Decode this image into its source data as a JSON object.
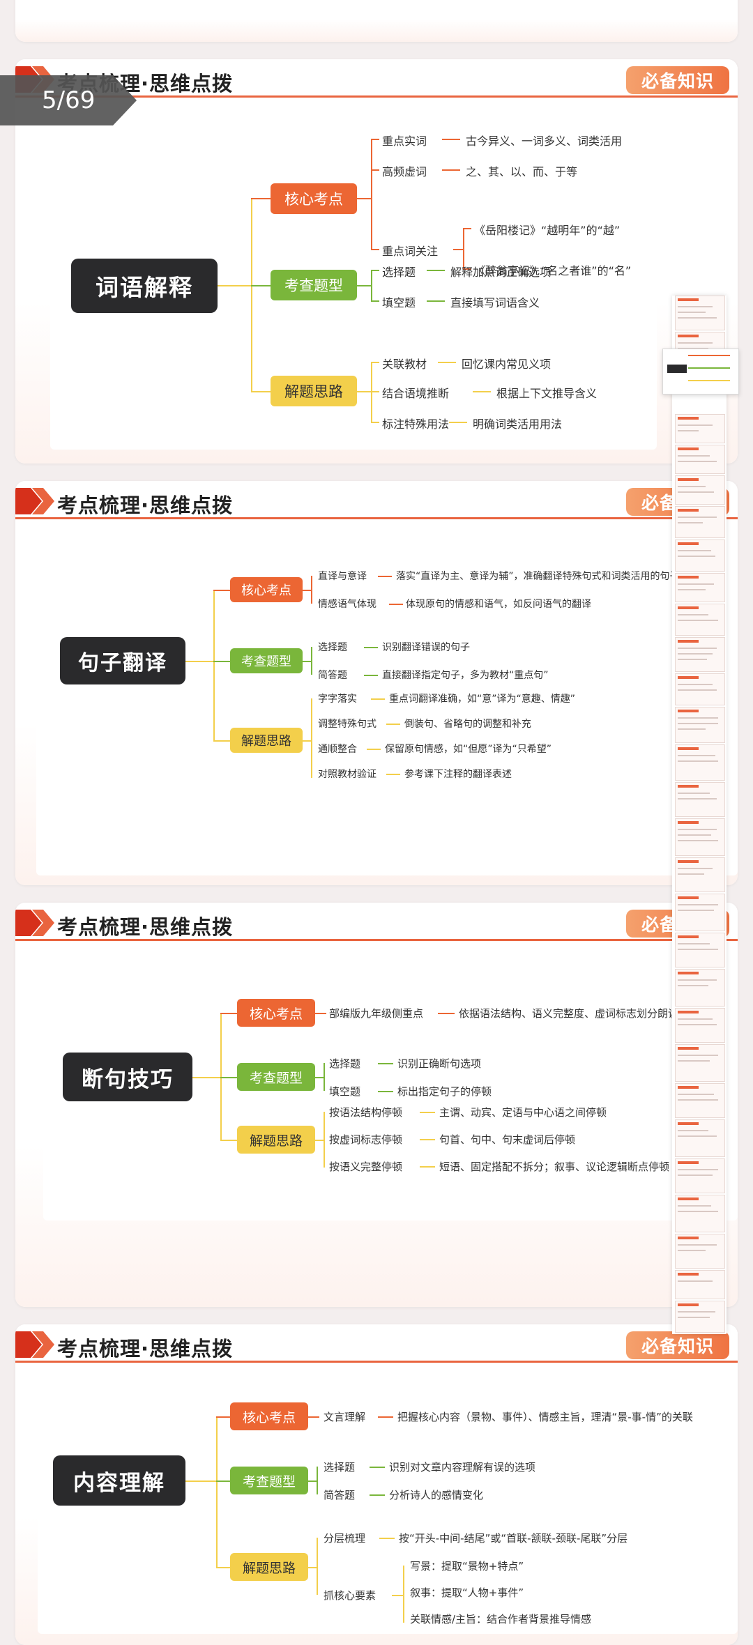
{
  "page_indicator": "5/69",
  "header_title": "考点梳理·思维点拨",
  "header_badge": "必备知识",
  "slides": [
    {
      "root": "词语解释",
      "branches": [
        {
          "label": "核心考点",
          "leaves": [
            {
              "label": "重点实词",
              "detail": "古今异义、一词多义、词类活用"
            },
            {
              "label": "高频虚词",
              "detail": "之、其、以、而、于等"
            },
            {
              "label": "重点词关注",
              "details": [
                "《岳阳楼记》“越明年”的“越”",
                "《醉翁亭记》“名之者谁”的“名”"
              ]
            }
          ]
        },
        {
          "label": "考查题型",
          "leaves": [
            {
              "label": "选择题",
              "detail": "解释加点词正确选项"
            },
            {
              "label": "填空题",
              "detail": "直接填写词语含义"
            }
          ]
        },
        {
          "label": "解题思路",
          "leaves": [
            {
              "label": "关联教材",
              "detail": "回忆课内常见义项"
            },
            {
              "label": "结合语境推断",
              "detail": "根据上下文推导含义"
            },
            {
              "label": "标注特殊用法",
              "detail": "明确词类活用用法"
            }
          ]
        }
      ]
    },
    {
      "root": "句子翻译",
      "branches": [
        {
          "label": "核心考点",
          "leaves": [
            {
              "label": "直译与意译",
              "detail": "落实“直译为主、意译为辅”，准确翻译特殊句式和词类活用的句子"
            },
            {
              "label": "情感语气体现",
              "detail": "体现原句的情感和语气，如反问语气的翻译"
            }
          ]
        },
        {
          "label": "考查题型",
          "leaves": [
            {
              "label": "选择题",
              "detail": "识别翻译错误的句子"
            },
            {
              "label": "简答题",
              "detail": "直接翻译指定句子，多为教材“重点句”"
            }
          ]
        },
        {
          "label": "解题思路",
          "leaves": [
            {
              "label": "字字落实",
              "detail": "重点词翻译准确，如“意”译为“意趣、情趣”"
            },
            {
              "label": "调整特殊句式",
              "detail": "倒装句、省略句的调整和补充"
            },
            {
              "label": "通顺整合",
              "detail": "保留原句情感，如“但愿”译为“只希望”"
            },
            {
              "label": "对照教材验证",
              "detail": "参考课下注释的翻译表述"
            }
          ]
        }
      ]
    },
    {
      "root": "断句技巧",
      "branches": [
        {
          "label": "核心考点",
          "leaves": [
            {
              "label": "部编版九年级侧重点",
              "detail": "依据语法结构、语义完整度、虚词标志划分朗读"
            }
          ]
        },
        {
          "label": "考查题型",
          "leaves": [
            {
              "label": "选择题",
              "detail": "识别正确断句选项"
            },
            {
              "label": "填空题",
              "detail": "标出指定句子的停顿"
            }
          ]
        },
        {
          "label": "解题思路",
          "leaves": [
            {
              "label": "按语法结构停顿",
              "detail": "主谓、动宾、定语与中心语之间停顿"
            },
            {
              "label": "按虚词标志停顿",
              "detail": "句首、句中、句末虚词后停顿"
            },
            {
              "label": "按语义完整停顿",
              "detail": "短语、固定搭配不拆分；叙事、议论逻辑断点停顿"
            }
          ]
        }
      ]
    },
    {
      "root": "内容理解",
      "branches": [
        {
          "label": "核心考点",
          "leaves": [
            {
              "label": "文言理解",
              "detail": "把握核心内容（景物、事件）、情感主旨，理清“景-事-情”的关联"
            }
          ]
        },
        {
          "label": "考查题型",
          "leaves": [
            {
              "label": "选择题",
              "detail": "识别对文章内容理解有误的选项"
            },
            {
              "label": "简答题",
              "detail": "分析诗人的感情变化"
            }
          ]
        },
        {
          "label": "解题思路",
          "leaves": [
            {
              "label": "分层梳理",
              "detail": "按“开头-中间-结尾”或“首联-颔联-颈联-尾联”分层"
            },
            {
              "label": "抓核心要素",
              "details": [
                "写景：提取“景物+特点”",
                "叙事：提取“人物+事件”",
                "关联情感/主旨：结合作者背景推导情感"
              ]
            }
          ]
        }
      ]
    }
  ]
}
